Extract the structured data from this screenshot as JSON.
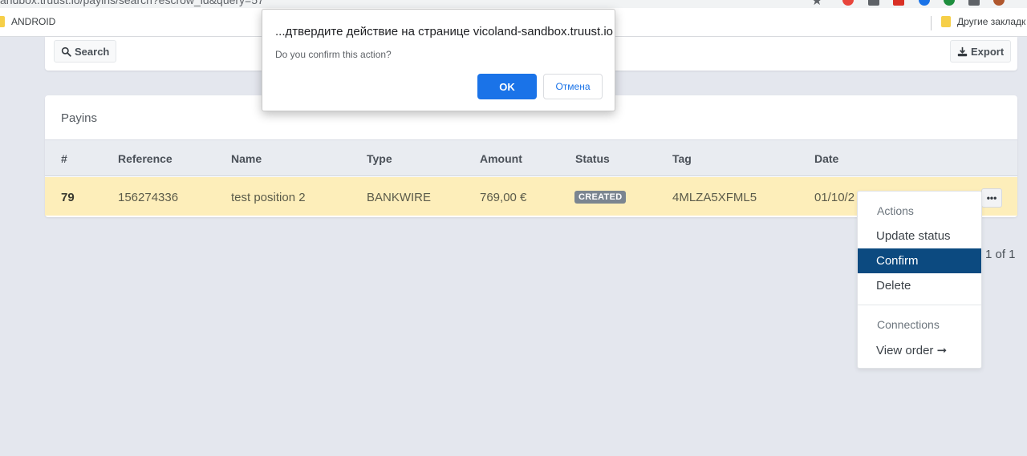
{
  "browser": {
    "url": "andbox.truust.io/payins/search?escrow_id&query=57",
    "bookmarks": [
      {
        "label": "ANDROID"
      },
      {
        "label": "Другие закладк"
      }
    ],
    "extension_colors": [
      "#e8453c",
      "#5f6368",
      "#d93025",
      "#1a73e8",
      "#1e8e3e",
      "#5f6368",
      "#b0582e"
    ]
  },
  "toolbar": {
    "search_label": "Search",
    "export_label": "Export"
  },
  "payins": {
    "title": "Payins",
    "columns": [
      "#",
      "Reference",
      "Name",
      "Type",
      "Amount",
      "Status",
      "Tag",
      "Date"
    ],
    "rows": [
      {
        "id": "79",
        "reference": "156274336",
        "name": "test position 2",
        "type": "BANKWIRE",
        "amount": "769,00 €",
        "status": "CREATED",
        "tag": "4MLZA5XFML5",
        "date": "01/10/2"
      }
    ],
    "more_label": "•••",
    "pagination": "1 of 1"
  },
  "dropdown": {
    "actions_header": "Actions",
    "update_status": "Update status",
    "confirm": "Confirm",
    "delete": "Delete",
    "connections_header": "Connections",
    "view_order": "View order ➞"
  },
  "dialog": {
    "title": "...дтвердите действие на странице vicoland-sandbox.truust.io",
    "message": "Do you confirm this action?",
    "ok_label": "OK",
    "cancel_label": "Отмена"
  },
  "colors": {
    "row_highlight": "#fdeeba",
    "accent": "#0c4a80",
    "dialog_ok": "#1a73e8",
    "badge": "#7b8590"
  }
}
